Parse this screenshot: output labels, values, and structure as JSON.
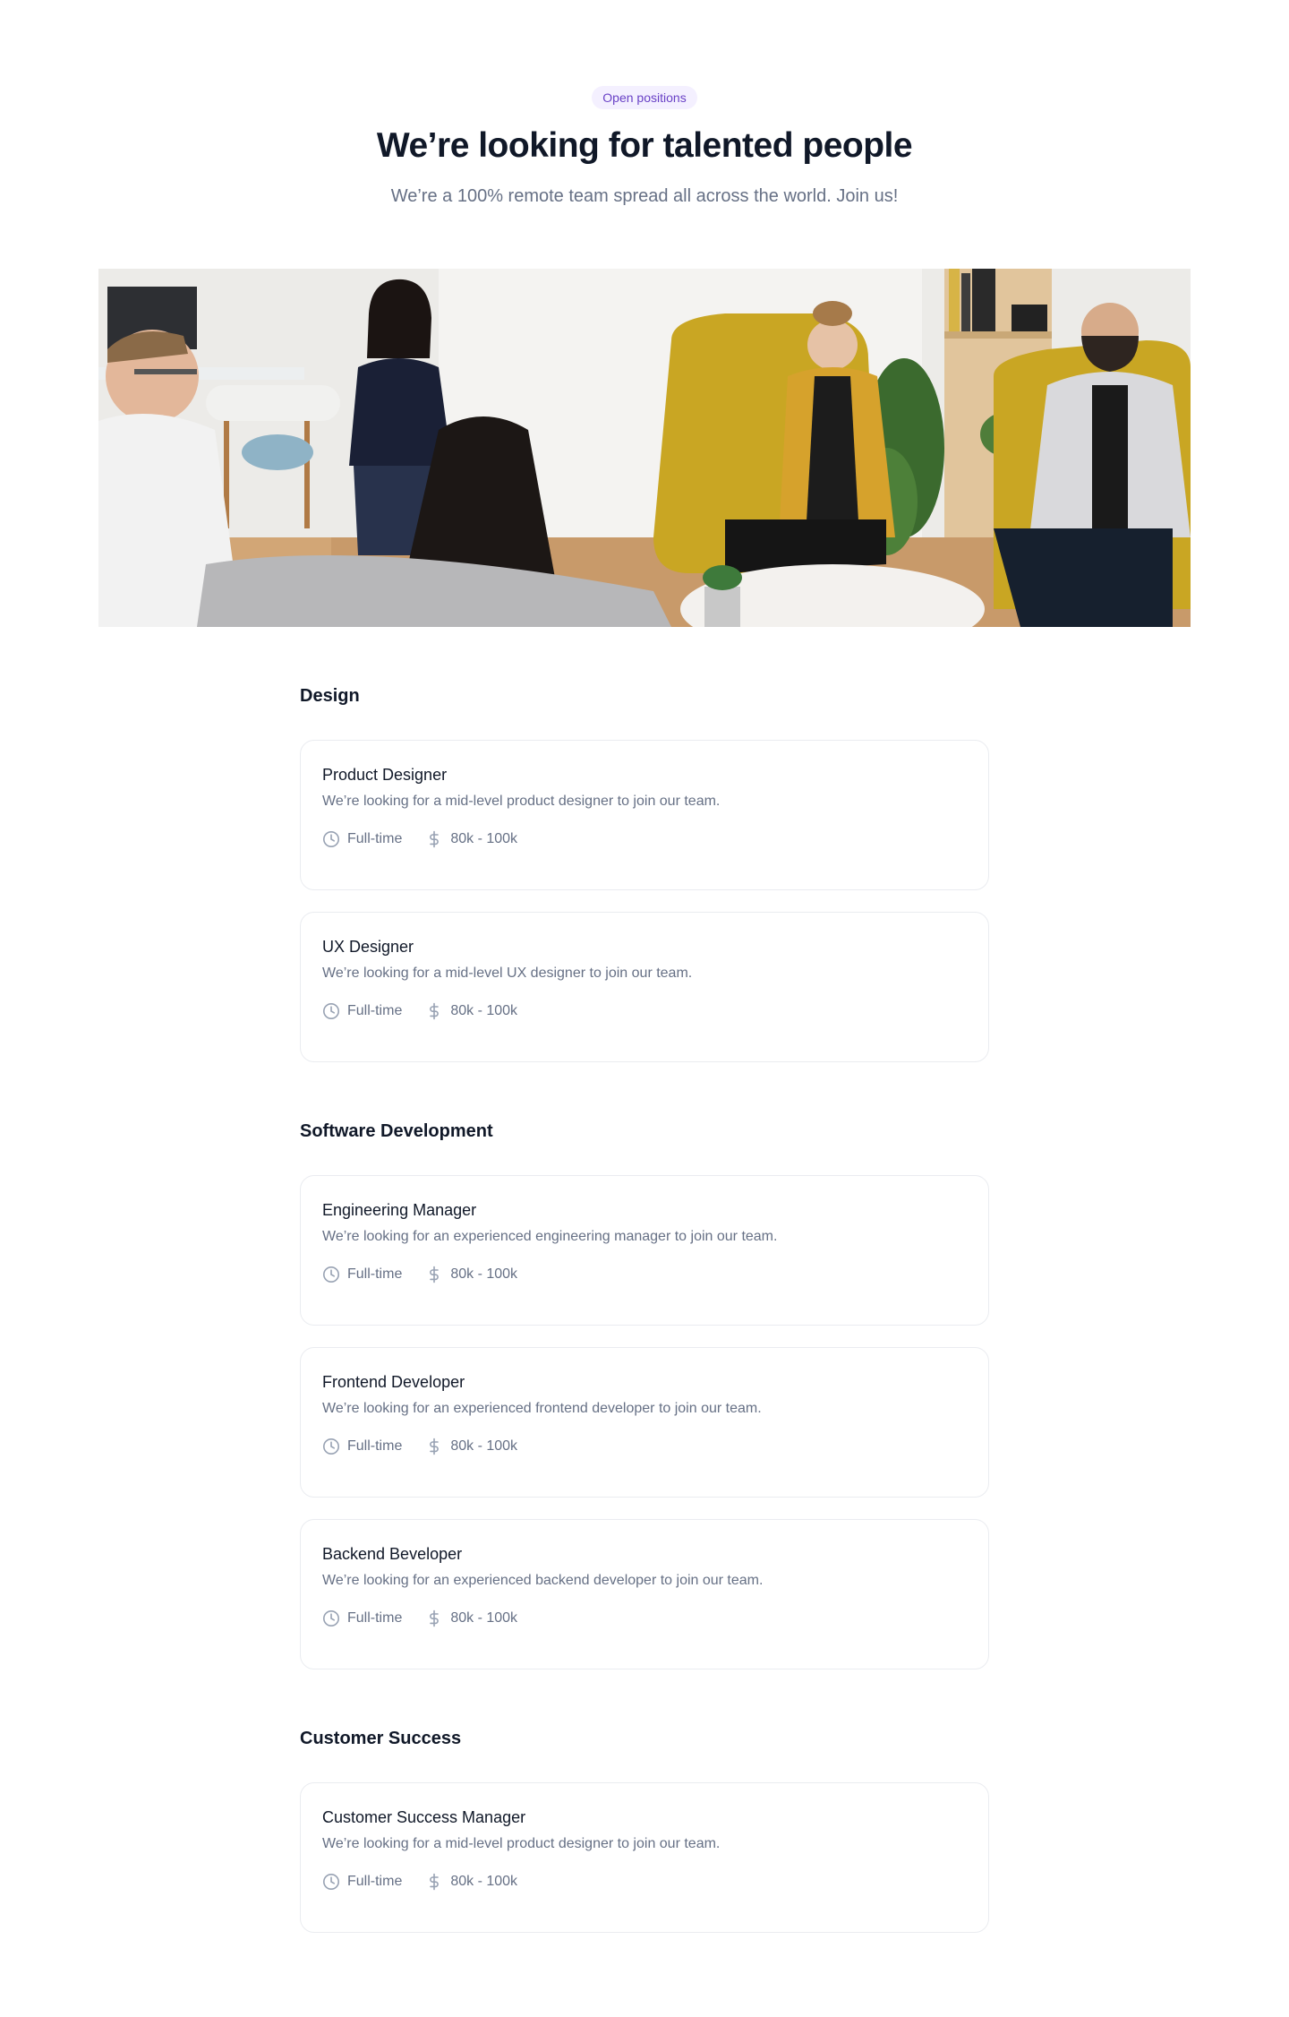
{
  "hero": {
    "badge": "Open positions",
    "title": "We’re looking for talented people",
    "subtitle": "We’re a 100% remote team spread all across the world. Join us!"
  },
  "departments": [
    {
      "name": "Design",
      "jobs": [
        {
          "title": "Product Designer",
          "description": "We’re looking for a mid-level product designer to join our team.",
          "type": "Full-time",
          "salary": "80k - 100k"
        },
        {
          "title": "UX Designer",
          "description": "We’re looking for a mid-level UX designer to join our team.",
          "type": "Full-time",
          "salary": "80k - 100k"
        }
      ]
    },
    {
      "name": "Software Development",
      "jobs": [
        {
          "title": "Engineering Manager",
          "description": "We’re looking for an experienced engineering manager to join our team.",
          "type": "Full-time",
          "salary": "80k - 100k"
        },
        {
          "title": "Frontend Developer",
          "description": "We’re looking for an experienced frontend developer to join our team.",
          "type": "Full-time",
          "salary": "80k - 100k"
        },
        {
          "title": "Backend Beveloper",
          "description": "We’re looking for an experienced backend developer to join our team.",
          "type": "Full-time",
          "salary": "80k - 100k"
        }
      ]
    },
    {
      "name": "Customer Success",
      "jobs": [
        {
          "title": "Customer Success Manager",
          "description": "We’re looking for a mid-level product designer to join our team.",
          "type": "Full-time",
          "salary": "80k - 100k"
        }
      ]
    }
  ],
  "icons": {
    "type": "clock-icon",
    "salary": "dollar-icon"
  },
  "colors": {
    "accent": "#6941c6",
    "badge_bg": "#f4f0ff",
    "muted": "#667085",
    "border": "#eaecf0"
  }
}
